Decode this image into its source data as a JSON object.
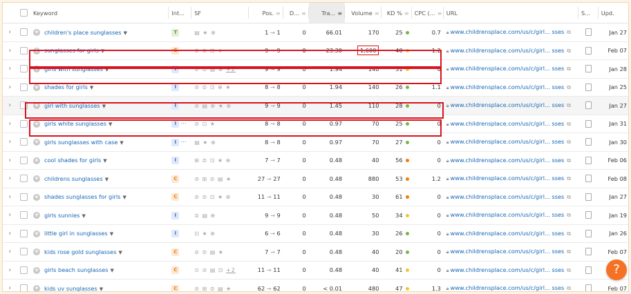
{
  "columns": {
    "keyword": "Keyword",
    "intent": "Int...",
    "sf": "SF",
    "pos": "Pos.",
    "diff": "D...",
    "traffic": "Tra...",
    "volume": "Volume",
    "kd": "KD %",
    "cpc": "CPC (...",
    "url": "URL",
    "snippet": "S...",
    "updated": "Upd."
  },
  "icons": {
    "expand": "chevron-right-icon",
    "add": "plus-circle-icon",
    "dropdown": "caret-down-icon",
    "sort": "sort-icon",
    "lock": "lock-icon",
    "external": "external-link-icon",
    "snippet": "document-icon",
    "help": "question-icon"
  },
  "colors": {
    "link": "#1566b7",
    "highlight_box": "#d8121e",
    "help_button": "#f57224",
    "intent_T": "#6fa94a",
    "intent_C": "#f28c28",
    "intent_I": "#4a7fd0",
    "kd_green": "#72b844",
    "kd_yellow": "#f4c430",
    "kd_orange": "#f57c00"
  },
  "help": {
    "label": "?"
  },
  "rows": [
    {
      "keyword": "children's place sunglasses",
      "intents": [
        {
          "t": "T",
          "bg": "#e2f0d7",
          "fg": "#5a9a31"
        }
      ],
      "sf": "▤ ★ ⊕",
      "sf_extra": "",
      "pos_from": "1",
      "pos_to": "1",
      "diff": "0",
      "traffic": "66.01",
      "volume": "170",
      "kd": "25",
      "kd_color": "#72b844",
      "cpc": "0.7",
      "url": "www.childrensplace.com/us/c/girl... sses",
      "updated": "Jan 27",
      "hl": false
    },
    {
      "keyword": "sunglasses for girls",
      "intents": [
        {
          "t": "C",
          "bg": "#fde7d2",
          "fg": "#e57a10"
        }
      ],
      "sf": "⊕ ⊜ ⊡ ★",
      "sf_extra": "",
      "pos_from": "9",
      "pos_to": "9",
      "diff": "0",
      "traffic": "23.30",
      "volume": "1,600",
      "kd": "40",
      "kd_color": "#f4c430",
      "cpc": "1.2",
      "url": "www.childrensplace.com/us/c/girl... sses",
      "updated": "Feb 07",
      "hl": false,
      "volume_boxed": true
    },
    {
      "keyword": "girls with sunglasses",
      "intents": [
        {
          "t": "I",
          "bg": "#dfe9fa",
          "fg": "#3b6fc4"
        }
      ],
      "sf": "⊘ ⊜ ▤ ⊕ ",
      "sf_extra": "+2",
      "pos_from": "9",
      "pos_to": "9",
      "diff": "0",
      "traffic": "1.94",
      "volume": "140",
      "kd": "31",
      "kd_color": "#f4c430",
      "cpc": "0",
      "url": "www.childrensplace.com/us/c/girl... sses",
      "updated": "Jan 28",
      "hl": false
    },
    {
      "keyword": "shades for girls",
      "intents": [
        {
          "t": "I",
          "bg": "#dfe9fa",
          "fg": "#3b6fc4"
        }
      ],
      "sf": "⊘ ⊜ ⊡ ⊕ ★",
      "sf_extra": "",
      "pos_from": "8",
      "pos_to": "8",
      "diff": "0",
      "traffic": "1.94",
      "volume": "140",
      "kd": "26",
      "kd_color": "#72b844",
      "cpc": "1.1",
      "url": "www.childrensplace.com/us/c/girl... sses",
      "updated": "Jan 25",
      "hl": false
    },
    {
      "keyword": "girl with sunglasses",
      "intents": [
        {
          "t": "I",
          "bg": "#dfe9fa",
          "fg": "#3b6fc4"
        }
      ],
      "sf": "⊘ ▤ ⊕ ★ ⊕",
      "sf_extra": "",
      "pos_from": "9",
      "pos_to": "9",
      "diff": "0",
      "traffic": "1.45",
      "volume": "110",
      "kd": "28",
      "kd_color": "#72b844",
      "cpc": "0",
      "url": "www.childrensplace.com/us/c/girl... sses",
      "updated": "Jan 27",
      "hl": true
    },
    {
      "keyword": "girls white sunglasses",
      "intents": [
        {
          "t": "I",
          "bg": "#dfe9fa",
          "fg": "#3b6fc4"
        },
        {
          "t": "T",
          "bg": "#e2f0d7",
          "fg": "#5a9a31"
        }
      ],
      "sf": "⊘ ⊡ ★",
      "sf_extra": "",
      "pos_from": "8",
      "pos_to": "8",
      "diff": "0",
      "traffic": "0.97",
      "volume": "70",
      "kd": "25",
      "kd_color": "#72b844",
      "cpc": "0",
      "url": "www.childrensplace.com/us/c/girl... sses",
      "updated": "Jan 31",
      "hl": false
    },
    {
      "keyword": "girls sunglasses with case",
      "intents": [
        {
          "t": "I",
          "bg": "#dfe9fa",
          "fg": "#3b6fc4"
        },
        {
          "t": "T",
          "bg": "#e2f0d7",
          "fg": "#5a9a31"
        }
      ],
      "sf": "▤ ★ ⊕",
      "sf_extra": "",
      "pos_from": "8",
      "pos_to": "8",
      "diff": "0",
      "traffic": "0.97",
      "volume": "70",
      "kd": "27",
      "kd_color": "#72b844",
      "cpc": "0",
      "url": "www.childrensplace.com/us/c/girl... sses",
      "updated": "Jan 30",
      "hl": false
    },
    {
      "keyword": "cool shades for girls",
      "intents": [
        {
          "t": "I",
          "bg": "#dfe9fa",
          "fg": "#3b6fc4"
        }
      ],
      "sf": "⊞ ⊜ ⊡ ★ ⊕",
      "sf_extra": "",
      "pos_from": "7",
      "pos_to": "7",
      "diff": "0",
      "traffic": "0.48",
      "volume": "40",
      "kd": "56",
      "kd_color": "#f57c00",
      "cpc": "0",
      "url": "www.childrensplace.com/us/c/girl... sses",
      "updated": "Feb 06",
      "hl": false
    },
    {
      "keyword": "childrens sunglasses",
      "intents": [
        {
          "t": "C",
          "bg": "#fde7d2",
          "fg": "#e57a10"
        }
      ],
      "sf": "⊘ ⊞ ⊜ ▤ ★",
      "sf_extra": "",
      "pos_from": "27",
      "pos_to": "27",
      "diff": "0",
      "traffic": "0.48",
      "volume": "880",
      "kd": "53",
      "kd_color": "#f57c00",
      "cpc": "1.2",
      "url": "www.childrensplace.com/us/c/girl... sses",
      "updated": "Feb 08",
      "hl": false
    },
    {
      "keyword": "shades sunglasses for girls",
      "intents": [
        {
          "t": "C",
          "bg": "#fde7d2",
          "fg": "#e57a10"
        }
      ],
      "sf": "⊘ ⊜ ⊡ ★ ⊕",
      "sf_extra": "",
      "pos_from": "11",
      "pos_to": "11",
      "diff": "0",
      "traffic": "0.48",
      "volume": "30",
      "kd": "61",
      "kd_color": "#f57c00",
      "cpc": "0",
      "url": "www.childrensplace.com/us/c/girl... sses",
      "updated": "Jan 27",
      "hl": false
    },
    {
      "keyword": "girls sunnies",
      "intents": [
        {
          "t": "I",
          "bg": "#dfe9fa",
          "fg": "#3b6fc4"
        }
      ],
      "sf": "⊜ ▤ ⊕",
      "sf_extra": "",
      "pos_from": "9",
      "pos_to": "9",
      "diff": "0",
      "traffic": "0.48",
      "volume": "50",
      "kd": "34",
      "kd_color": "#f4c430",
      "cpc": "0",
      "url": "www.childrensplace.com/us/c/girl... sses",
      "updated": "Jan 19",
      "hl": false
    },
    {
      "keyword": "little girl in sunglasses",
      "intents": [
        {
          "t": "I",
          "bg": "#dfe9fa",
          "fg": "#3b6fc4"
        }
      ],
      "sf": "⊡ ★ ⊕",
      "sf_extra": "",
      "pos_from": "6",
      "pos_to": "6",
      "diff": "0",
      "traffic": "0.48",
      "volume": "30",
      "kd": "26",
      "kd_color": "#72b844",
      "cpc": "0",
      "url": "www.childrensplace.com/us/c/girl... sses",
      "updated": "Jan 26",
      "hl": false
    },
    {
      "keyword": "kids rose gold sunglasses",
      "intents": [
        {
          "t": "C",
          "bg": "#fde7d2",
          "fg": "#e57a10"
        }
      ],
      "sf": "⊘ ⊜ ▤ ★",
      "sf_extra": "",
      "pos_from": "7",
      "pos_to": "7",
      "diff": "0",
      "traffic": "0.48",
      "volume": "40",
      "kd": "20",
      "kd_color": "#72b844",
      "cpc": "0",
      "url": "www.childrensplace.com/us/c/girl... sses",
      "updated": "Feb 07",
      "hl": false
    },
    {
      "keyword": "girls beach sunglasses",
      "intents": [
        {
          "t": "C",
          "bg": "#fde7d2",
          "fg": "#e57a10"
        }
      ],
      "sf": "⊙ ⊘ ▤ ⊡ ",
      "sf_extra": "+2",
      "pos_from": "11",
      "pos_to": "11",
      "diff": "0",
      "traffic": "0.48",
      "volume": "40",
      "kd": "41",
      "kd_color": "#f4c430",
      "cpc": "0",
      "url": "www.childrensplace.com/us/c/girl... sses",
      "updated": "Feb 07",
      "hl": false
    },
    {
      "keyword": "kids uv sunglasses",
      "intents": [
        {
          "t": "C",
          "bg": "#fde7d2",
          "fg": "#e57a10"
        }
      ],
      "sf": "⊘ ⊞ ⊜ ▤ ★",
      "sf_extra": "",
      "pos_from": "62",
      "pos_to": "62",
      "diff": "0",
      "traffic": "< 0.01",
      "volume": "480",
      "kd": "47",
      "kd_color": "#f4c430",
      "cpc": "1.3",
      "url": "www.childrensplace.com/us/c/girl... sses",
      "updated": "Feb 07",
      "hl": false
    }
  ]
}
